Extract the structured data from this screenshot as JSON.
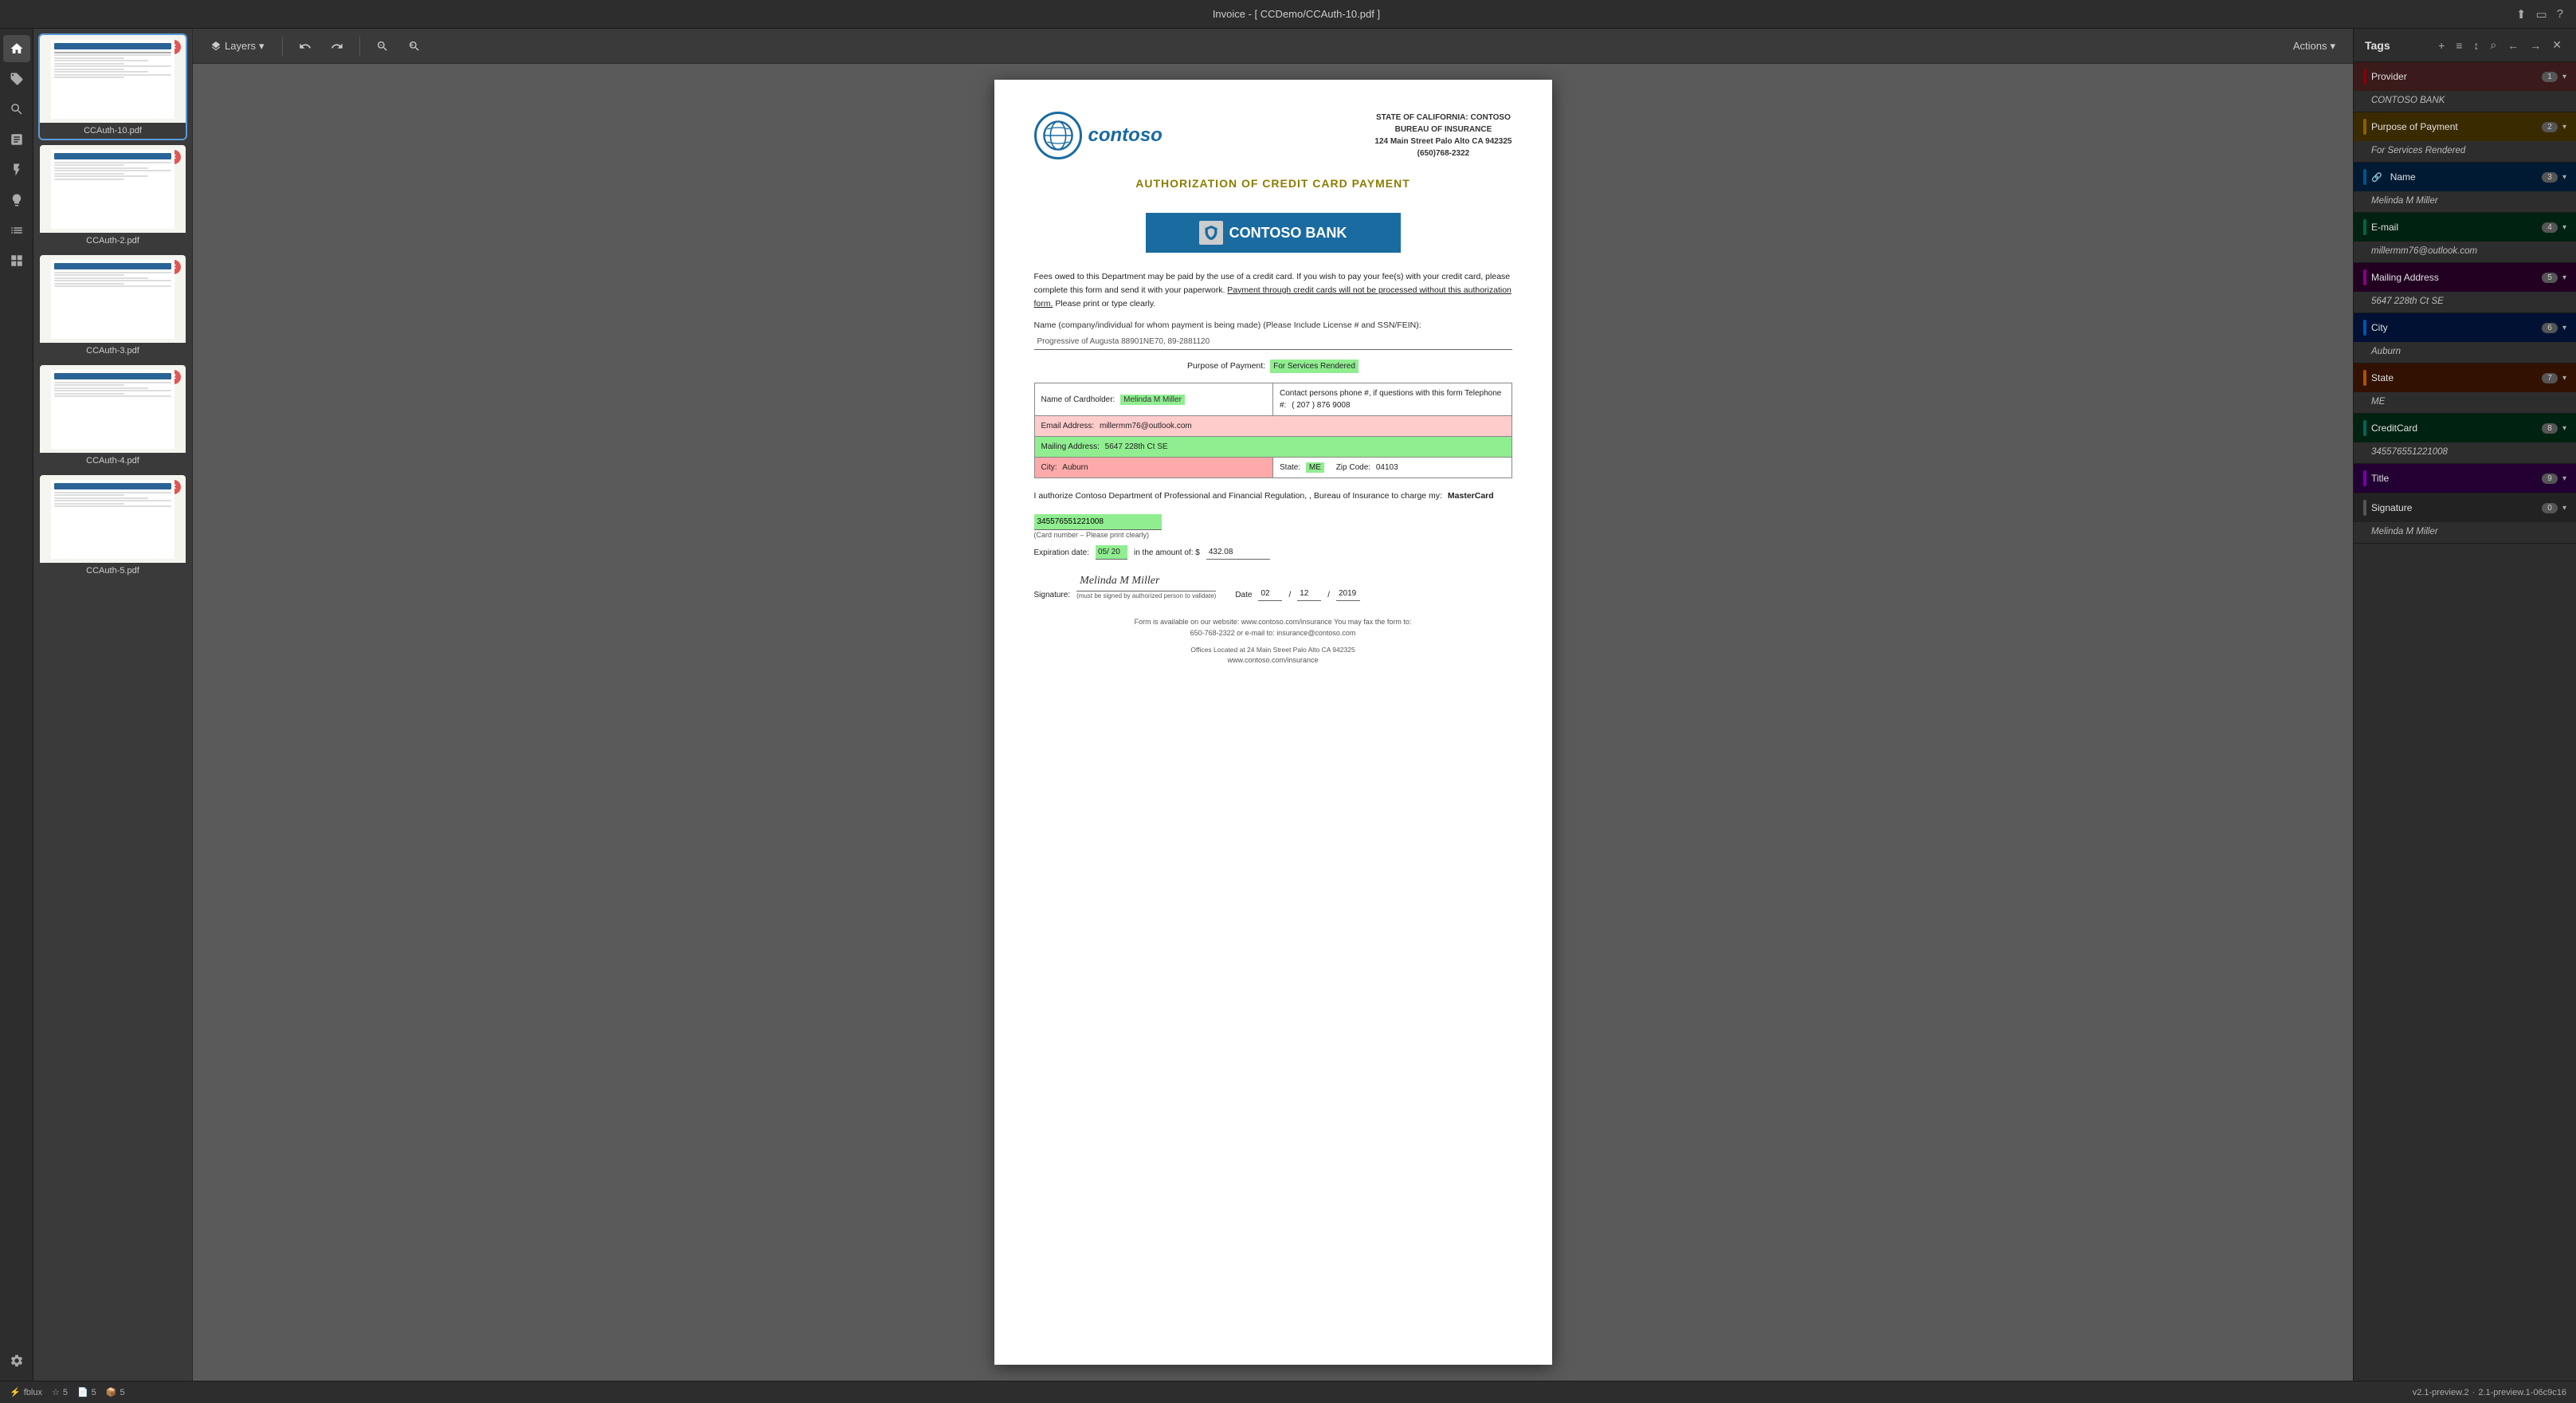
{
  "titleBar": {
    "title": "Invoice - [ CCDemo/CCAuth-10.pdf ]",
    "icons": [
      "share-icon",
      "tablet-icon",
      "help-icon"
    ]
  },
  "toolbar": {
    "layers_label": "Layers",
    "actions_label": "Actions",
    "icons": [
      "undo-icon",
      "redo-icon",
      "zoom-out-icon",
      "zoom-in-icon"
    ]
  },
  "thumbnails": [
    {
      "label": "CCAuth-10.pdf",
      "active": true,
      "badge": true
    },
    {
      "label": "CCAuth-2.pdf",
      "active": false,
      "badge": true
    },
    {
      "label": "CCAuth-3.pdf",
      "active": false,
      "badge": true
    },
    {
      "label": "CCAuth-4.pdf",
      "active": false,
      "badge": true
    },
    {
      "label": "CCAuth-5.pdf",
      "active": false,
      "badge": true
    }
  ],
  "document": {
    "logo_text": "contoso",
    "header_agency": "STATE OF CALIFORNIA: CONTOSO",
    "header_bureau": "BUREAU OF INSURANCE",
    "header_address": "124 Main Street Palo Alto CA 942325",
    "header_phone": "(650)768-2322",
    "doc_title": "AUTHORIZATION OF CREDIT CARD PAYMENT",
    "bank_name": "CONTOSO BANK",
    "body_text": "Fees owed to this Department may be paid by the use of a credit card.  If you wish to pay your fee(s) with your credit card, please complete this form and send it with your paperwork.  Payment through credit cards will not be processed without this authorization form.  Please print or type clearly.",
    "name_field_label": "Name (company/individual for whom payment is being made) (Please Include License # and SSN/FEIN):",
    "name_field_value": "Progressive of Augusta  88901NE70,  89-2881120",
    "purpose_label": "Purpose of Payment:",
    "purpose_value": "For Services Rendered",
    "cardholder_label": "Name of Cardholder:",
    "cardholder_value": "Melinda M Miller",
    "contact_label": "Contact persons phone #, if questions with this form  Telephone #:",
    "contact_value": "( 207 )  876  9008",
    "email_label": "Email Address:",
    "email_value": "millermm76@outlook.com",
    "mailing_label": "Mailing Address:",
    "mailing_value": "5647 228th Ct SE",
    "city_label": "City:",
    "city_value": "Auburn",
    "state_label": "State:",
    "state_value": "ME",
    "zip_label": "Zip Code:",
    "zip_value": "04103",
    "auth_text": "I authorize Contoso Department of Professional and Financial Regulation, , Bureau of Insurance to charge my:",
    "card_type": "MasterCard",
    "card_number": "345576551221008",
    "card_number_note": "(Card number – Please print clearly)",
    "expiry_label": "Expiration date:",
    "expiry_value": "05/ 20",
    "amount_label": "in the amount of: $",
    "amount_value": "432.08",
    "signature_label": "Signature:",
    "signature_value": "Melinda M Miller",
    "sig_note": "(must be signed by authorized person to validate)",
    "date_label": "Date",
    "date_month": "02",
    "date_day": "12",
    "date_year": "2019",
    "footer1": "Form is available on our website:  www.contoso.com/insurance  You may fax the form to:",
    "footer2": "650-768-2322 or e-mail to:  insurance@contoso.com",
    "footer3": "Offices Located at 24 Main Street Palo Alto CA 942325",
    "footer4": "www.contoso.com/insurance"
  },
  "tags": {
    "panel_title": "Tags",
    "items": [
      {
        "id": "provider",
        "name": "Provider",
        "count": "1",
        "value": "CONTOSO BANK",
        "color_class": "tag-provider"
      },
      {
        "id": "purpose",
        "name": "Purpose of Payment",
        "count": "2",
        "value": "For Services Rendered",
        "color_class": "tag-payment"
      },
      {
        "id": "name",
        "name": "Name",
        "count": "3",
        "value": "Melinda M Miller",
        "color_class": "tag-name-tag"
      },
      {
        "id": "email",
        "name": "E-mail",
        "count": "4",
        "value": "millermm76@outlook.com",
        "color_class": "tag-email"
      },
      {
        "id": "address",
        "name": "Mailing Address",
        "count": "5",
        "value": "5647 228th Ct SE",
        "color_class": "tag-address"
      },
      {
        "id": "city",
        "name": "City",
        "count": "6",
        "value": "Auburn",
        "color_class": "tag-city"
      },
      {
        "id": "state",
        "name": "State",
        "count": "7",
        "value": "ME",
        "color_class": "tag-state"
      },
      {
        "id": "credit",
        "name": "CreditCard",
        "count": "8",
        "value": "345576551221008",
        "color_class": "tag-credit"
      },
      {
        "id": "title",
        "name": "Title",
        "count": "9",
        "value": "",
        "color_class": "tag-title-tag"
      },
      {
        "id": "sig",
        "name": "Signature",
        "count": "0",
        "value": "Melinda M Miller",
        "color_class": "tag-sig"
      }
    ]
  },
  "statusBar": {
    "app": "fblux",
    "stars": "5",
    "pages": "5",
    "items": "5",
    "version": "v2.1-preview.2",
    "build": "2.1-preview.1-06c9c16"
  }
}
